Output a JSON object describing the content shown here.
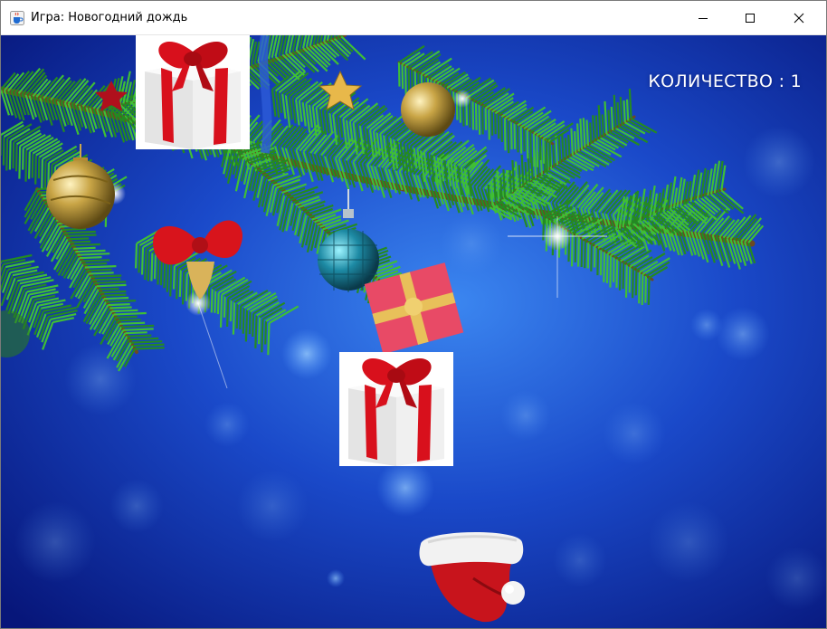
{
  "window": {
    "title": "Игра: Новогодний дождь",
    "icon": "java-cup-icon",
    "controls": [
      "minimize-icon",
      "maximize-icon",
      "close-icon"
    ]
  },
  "hud": {
    "counter_text": "КОЛИЧЕСТВО : 1"
  },
  "game": {
    "background": "christmas-tree-branch-blue-bokeh",
    "falling_items": [
      "gift-box",
      "gift-box"
    ],
    "player": "santa-hat"
  },
  "colors": {
    "sky_dark": "#0a1f8a",
    "sky_light": "#2f6fe0",
    "needles": "#2e9a2a",
    "gift_ribbon": "#d8101c",
    "hat_red": "#c8141c",
    "text": "#ffffff"
  }
}
